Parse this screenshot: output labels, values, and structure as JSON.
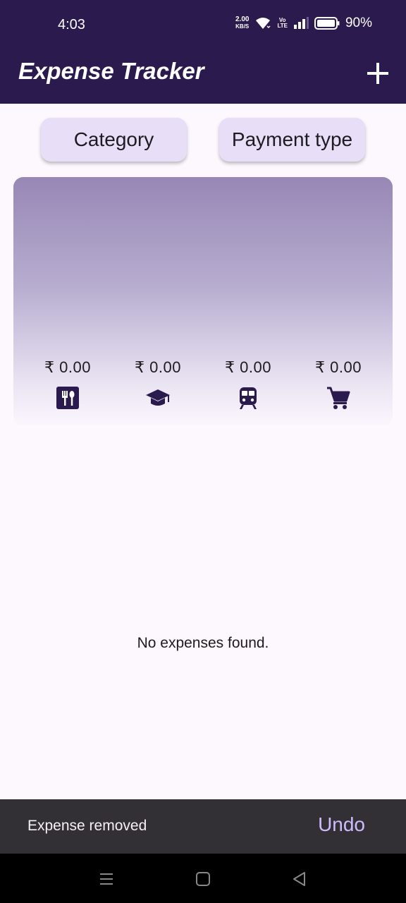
{
  "status": {
    "time": "4:03",
    "net_speed": "2.00",
    "net_unit": "KB/S",
    "volte_top": "Vo",
    "volte_bottom": "LTE",
    "battery": "90%"
  },
  "app_bar": {
    "title": "Expense Tracker",
    "add_icon": "plus-icon"
  },
  "filters": {
    "category": "Category",
    "payment_type": "Payment type"
  },
  "summary": {
    "items": [
      {
        "amount": "₹ 0.00",
        "icon": "food-icon"
      },
      {
        "amount": "₹ 0.00",
        "icon": "education-icon"
      },
      {
        "amount": "₹ 0.00",
        "icon": "train-icon"
      },
      {
        "amount": "₹ 0.00",
        "icon": "shopping-cart-icon"
      }
    ]
  },
  "list": {
    "empty_message": "No expenses found."
  },
  "snackbar": {
    "message": "Expense removed",
    "action": "Undo"
  },
  "colors": {
    "app_bar": "#2a1a4d",
    "button_bg": "#e8def8",
    "icon": "#2a1a4d",
    "snackbar_bg": "#322f35",
    "snackbar_action": "#cfbcff"
  }
}
